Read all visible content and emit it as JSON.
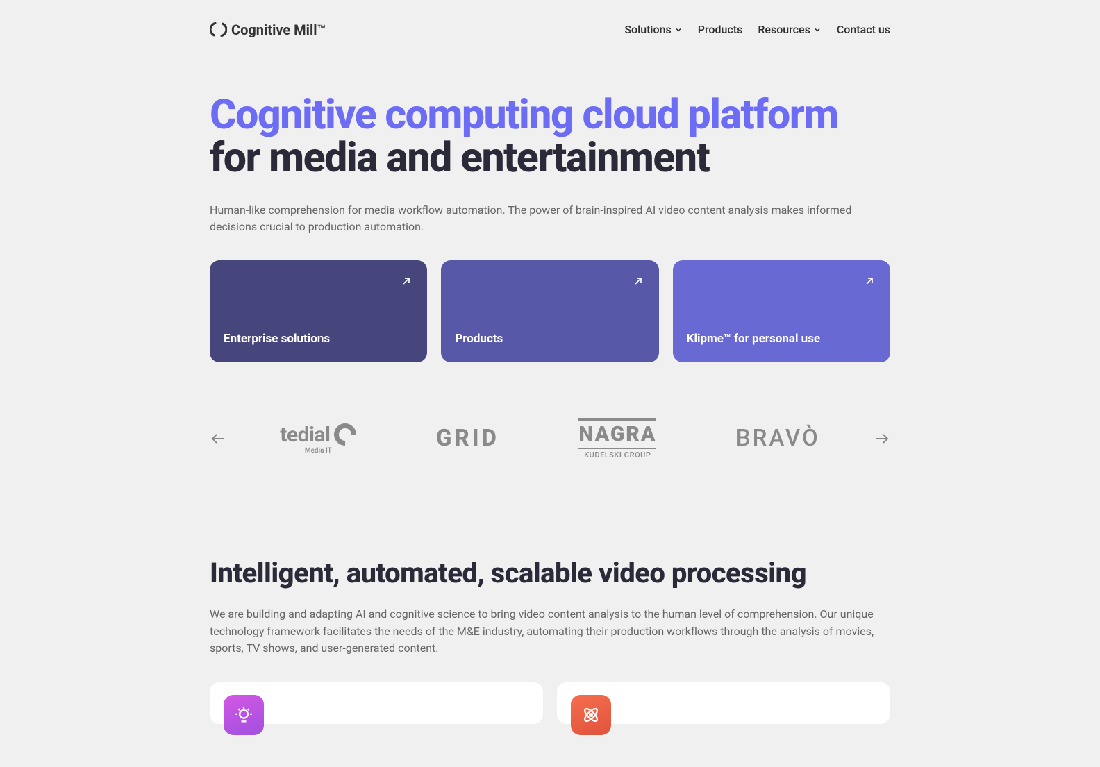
{
  "brand": {
    "name": "Cognitive Mill™"
  },
  "nav": {
    "solutions": "Solutions",
    "products": "Products",
    "resources": "Resources",
    "contact": "Contact us"
  },
  "hero": {
    "title_accent": "Cognitive computing cloud platform",
    "title_dark": "for media and entertainment",
    "subtitle": "Human-like comprehension for media workflow automation. The power of brain-inspired AI video content analysis makes informed decisions crucial to production automation."
  },
  "cards": [
    {
      "label": "Enterprise solutions"
    },
    {
      "label": "Products"
    },
    {
      "label": "Klipme™ for personal use"
    }
  ],
  "carousel": {
    "logos": {
      "tedial_main": "tedial",
      "tedial_sub": "Media IT",
      "grid": "GRID",
      "nagra_main": "NAGRA",
      "nagra_sub": "KUDELSKI GROUP",
      "bravo": "BRAVÒ"
    }
  },
  "section2": {
    "heading": "Intelligent, automated, scalable video processing",
    "body": "We are building and adapting AI and cognitive science to bring video content analysis to the human level of comprehension. Our unique technology framework facilitates the needs of the M&E industry, automating their production workflows through the analysis of movies, sports, TV shows, and user-generated content."
  }
}
